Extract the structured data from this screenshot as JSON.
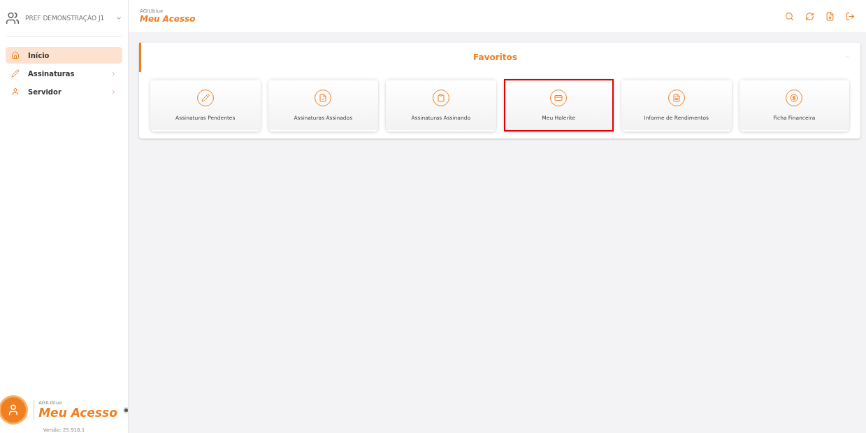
{
  "org": {
    "name": "PREF DEMONSTRAÇÃO J1"
  },
  "brand": {
    "tag": "AGILIblue",
    "title": "Meu Acesso"
  },
  "sidebar": {
    "items": [
      {
        "label": "Início",
        "kind": "link",
        "selected": true
      },
      {
        "label": "Assinaturas",
        "kind": "group",
        "selected": false
      },
      {
        "label": "Servidor",
        "kind": "group",
        "selected": false
      }
    ]
  },
  "footer": {
    "tag": "AGILIblue",
    "title": "Meu Acesso",
    "version": "Versão: 25.918.1"
  },
  "favorites": {
    "title": "Favoritos",
    "cards": [
      {
        "label": "Assinaturas Pendentes",
        "highlighted": false
      },
      {
        "label": "Assinaturas Assinados",
        "highlighted": false
      },
      {
        "label": "Assinaturas Assinando",
        "highlighted": false
      },
      {
        "label": "Meu Holerite",
        "highlighted": true
      },
      {
        "label": "Informe de Rendimentos",
        "highlighted": false
      },
      {
        "label": "Ficha Financeira",
        "highlighted": false
      }
    ]
  }
}
